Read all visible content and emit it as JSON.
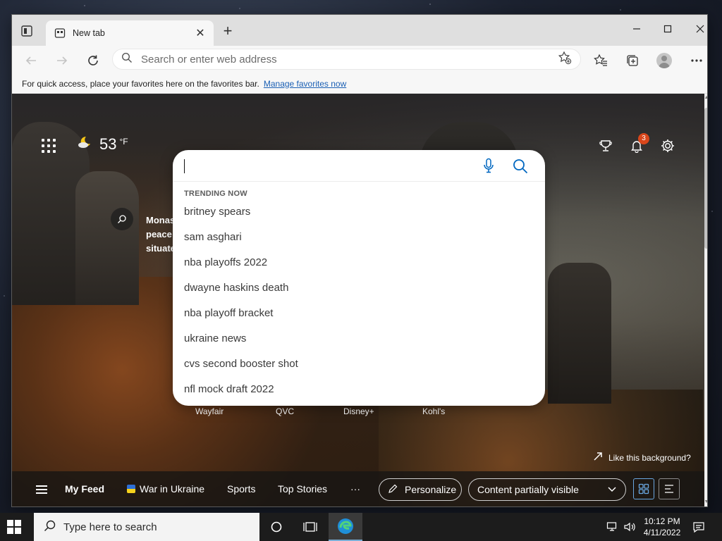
{
  "browser": {
    "tab_title": "New tab",
    "address_placeholder": "Search or enter web address",
    "favorites_bar": {
      "message": "For quick access, place your favorites here on the favorites bar.",
      "link": "Manage favorites now"
    }
  },
  "newtab": {
    "weather": {
      "temperature": "53",
      "unit": "°F",
      "icon": "moon-cloud-icon"
    },
    "notification_count": "3",
    "image_caption": [
      "Monas",
      "peace",
      "situate"
    ],
    "search": {
      "value": "",
      "trending_label": "TRENDING NOW",
      "suggestions": [
        "britney spears",
        "sam asghari",
        "nba playoffs 2022",
        "dwayne haskins death",
        "nba playoff bracket",
        "ukraine news",
        "cvs second booster shot",
        "nfl mock draft 2022"
      ]
    },
    "quick_links": [
      "Wayfair",
      "QVC",
      "Disney+",
      "Kohl's"
    ],
    "like_background": "Like this background?",
    "feed": {
      "my_feed": "My Feed",
      "war_in_ukraine": "War in Ukraine",
      "sports": "Sports",
      "top_stories": "Top Stories",
      "more": "···",
      "personalize": "Personalize",
      "content_visibility": "Content partially visible"
    }
  },
  "taskbar": {
    "search_placeholder": "Type here to search",
    "time": "10:12 PM",
    "date": "4/11/2022"
  },
  "colors": {
    "accent": "#0067c0",
    "notification_badge": "#d9461b",
    "edge_active_underline": "#7aaed6"
  }
}
